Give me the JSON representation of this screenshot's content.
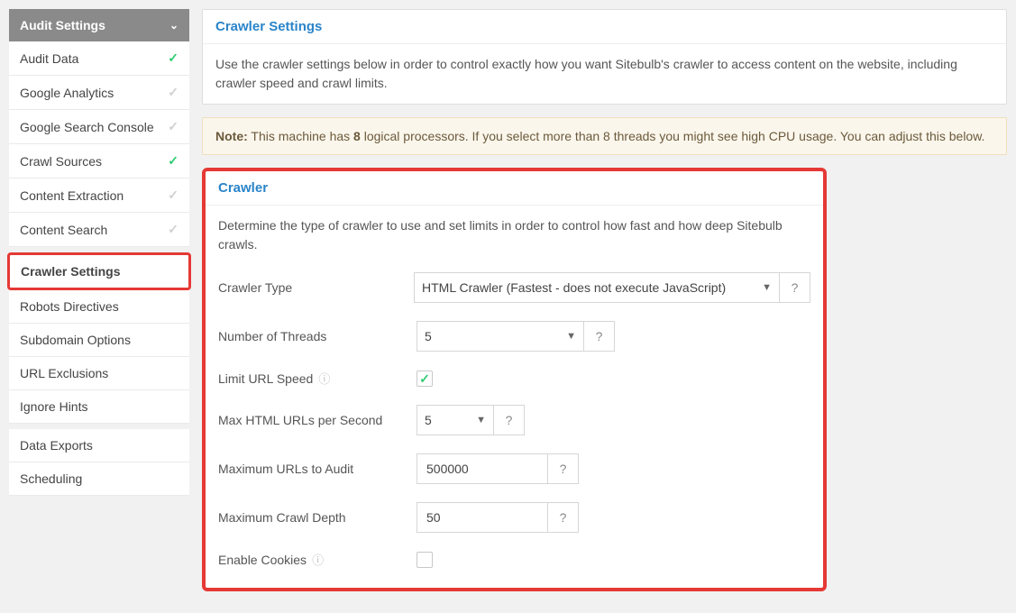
{
  "sidebar": {
    "header": "Audit Settings",
    "group1": [
      {
        "label": "Audit Data",
        "status": "green"
      },
      {
        "label": "Google Analytics",
        "status": "gray"
      },
      {
        "label": "Google Search Console",
        "status": "gray"
      },
      {
        "label": "Crawl Sources",
        "status": "green"
      },
      {
        "label": "Content Extraction",
        "status": "gray"
      },
      {
        "label": "Content Search",
        "status": "gray"
      }
    ],
    "active": {
      "label": "Crawler Settings"
    },
    "group2": [
      {
        "label": "Robots Directives"
      },
      {
        "label": "Subdomain Options"
      },
      {
        "label": "URL Exclusions"
      },
      {
        "label": "Ignore Hints"
      }
    ],
    "group3": [
      {
        "label": "Data Exports"
      },
      {
        "label": "Scheduling"
      }
    ]
  },
  "settings_card": {
    "title": "Crawler Settings",
    "text": "Use the crawler settings below in order to control exactly how you want Sitebulb's crawler to access content on the website, including crawler speed and crawl limits."
  },
  "note": {
    "prefix": "Note:",
    "text_a": " This machine has ",
    "count": "8",
    "text_b": " logical processors. If you select more than 8 threads you might see high CPU usage. You can adjust this below."
  },
  "crawler_card": {
    "title": "Crawler",
    "desc": "Determine the type of crawler to use and set limits in order to control how fast and how deep Sitebulb crawls.",
    "labels": {
      "crawler_type": "Crawler Type",
      "threads": "Number of Threads",
      "limit_speed": "Limit URL Speed",
      "max_html_urls": "Max HTML URLs per Second",
      "max_urls": "Maximum URLs to Audit",
      "max_depth": "Maximum Crawl Depth",
      "cookies": "Enable Cookies"
    },
    "values": {
      "crawler_type": "HTML Crawler (Fastest - does not execute JavaScript)",
      "threads": "5",
      "limit_speed_checked": true,
      "max_html_urls": "5",
      "max_urls": "500000",
      "max_depth": "50",
      "cookies_checked": false
    },
    "help_label": "?"
  }
}
